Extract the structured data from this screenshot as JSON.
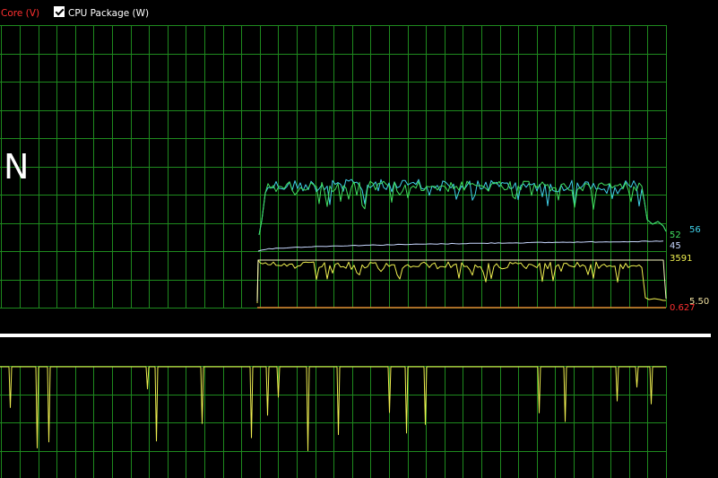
{
  "colors": {
    "background": "#000000",
    "grid": "#1e8a1e",
    "series_cyan": "#40d0e8",
    "series_green": "#40e060",
    "series_white": "#c8d8ff",
    "series_yellow": "#f0f050",
    "series_yellow_pale": "#f8f8c0",
    "series_orange": "#e08030",
    "separator": "#ffffff"
  },
  "legend": {
    "items": [
      {
        "label": "U Core (V)",
        "checked": true,
        "color": "#ff3030"
      },
      {
        "label": "CPU Package (W)",
        "checked": true,
        "color": "#ffffff"
      }
    ]
  },
  "top_chart": {
    "big_text": "N",
    "value_labels": [
      {
        "text": "56",
        "color": "#40d0e8"
      },
      {
        "text": "52",
        "color": "#40e060"
      },
      {
        "text": "45",
        "color": "#c8d8ff"
      },
      {
        "text": "3591",
        "color": "#f0f050"
      },
      {
        "text": "5.50",
        "color": "#f0e0a0"
      },
      {
        "text": "0.627",
        "color": "#ff3030"
      }
    ]
  },
  "chart_data": {
    "type": "line",
    "series": [
      {
        "name": "56",
        "color": "#40d0e8",
        "end_value": 56
      },
      {
        "name": "52",
        "color": "#40e060",
        "end_value": 52
      },
      {
        "name": "45",
        "color": "#c8d8ff",
        "end_value": 45
      },
      {
        "name": "3591",
        "color": "#f0f050",
        "end_value": 3591
      },
      {
        "name": "5.50",
        "color": "#f0e0a0",
        "end_value": 5.5
      },
      {
        "name": "0.627",
        "color": "#ff3030",
        "end_value": 0.627
      }
    ]
  }
}
